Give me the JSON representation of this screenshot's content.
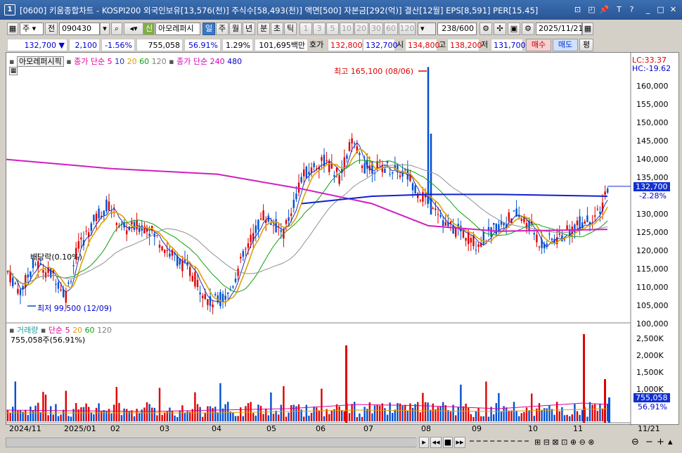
{
  "window": {
    "number": "1",
    "title": "[0600] 키움종합차트 - KOSPI200 외국인보유[13,576(천)] 주식수[58,493(천)] 액면[500] 자본금[292(억)] 결산[12월] EPS[8,591] PER[15.45]"
  },
  "toolbar": {
    "period": "주",
    "prev_btn": "전",
    "code": "090430",
    "new_badge": "신",
    "stock_name": "아모레퍼시",
    "periods": [
      "일",
      "주",
      "월",
      "년",
      "분",
      "초",
      "틱"
    ],
    "minutes": [
      "1",
      "3",
      "5",
      "10",
      "20",
      "30",
      "60",
      "120"
    ],
    "count": "238",
    "count_max": "/600",
    "date": "2025/11/21"
  },
  "quote": {
    "price": "132,700",
    "arrow": "▼",
    "change": "2,100",
    "change_pct": "-1.56%",
    "volume": "755,058",
    "vol_ratio": "56.91%",
    "turnover": "1.29%",
    "amount": "101,695백만",
    "bid_label": "호가",
    "bid": "132,800",
    "ask": "132,700",
    "open_label": "시",
    "open": "134,800",
    "high_label": "고",
    "high": "138,200",
    "low_label": "저",
    "low": "131,700",
    "buy": "매수",
    "sell": "매도",
    "eval": "평"
  },
  "legend": {
    "name": "아모레퍼시픽",
    "ma_prefix": "종가 단순",
    "ma": [
      "5",
      "10",
      "20",
      "60",
      "120"
    ],
    "ma_colors": [
      "#e0009a",
      "#2030c0",
      "#e0a000",
      "#10a010",
      "#808080"
    ],
    "ma2_prefix": "종가 단순",
    "ma2": [
      "240",
      "480"
    ],
    "ma2_colors": [
      "#d000c0",
      "#0000d0"
    ],
    "vol_prefix": "거래량",
    "vol_ma_prefix": "단순",
    "vol_ma": [
      "5",
      "20",
      "60",
      "120"
    ],
    "vol_value": "755,058주(56.91%)"
  },
  "annotations": {
    "high": "최고 165,100 (08/06)",
    "low": "최저 99,500 (12/09)",
    "dividend": "배당락(0.10%)",
    "lc": "LC:33.37",
    "hc": "HC:-19.62",
    "price_tag": "132,700",
    "price_pct": "-2.28%",
    "vol_tag": "755,058",
    "vol_pct": "56.91%"
  },
  "yaxis": [
    "160,000",
    "155,000",
    "150,000",
    "145,000",
    "140,000",
    "135,000",
    "130,000",
    "125,000",
    "120,000",
    "115,000",
    "110,000",
    "105,000",
    "100,000"
  ],
  "vol_axis": [
    "2,500K",
    "2,000K",
    "1,500K",
    "1,000K"
  ],
  "xaxis": [
    "2024/11",
    "2025/01",
    "02",
    "03",
    "04",
    "05",
    "06",
    "07",
    "08",
    "09",
    "10",
    "11",
    "11/21"
  ],
  "colors": {
    "up": "#e00000",
    "down": "#0050d0",
    "ma240": "#d020c0",
    "ma480": "#1020d0"
  }
}
